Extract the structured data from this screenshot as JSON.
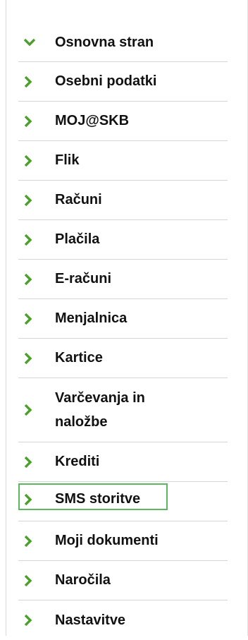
{
  "accent_color": "#4aa028",
  "highlight_color": "#5cb85c",
  "nav": {
    "items": [
      {
        "label": "Osnovna stran",
        "icon": "chevron-down-icon"
      },
      {
        "label": "Osebni podatki",
        "icon": "chevron-right-icon"
      },
      {
        "label": "MOJ@SKB",
        "icon": "chevron-right-icon"
      },
      {
        "label": "Flik",
        "icon": "chevron-right-icon"
      },
      {
        "label": "Računi",
        "icon": "chevron-right-icon"
      },
      {
        "label": "Plačila",
        "icon": "chevron-right-icon"
      },
      {
        "label": "E-računi",
        "icon": "chevron-right-icon"
      },
      {
        "label": "Menjalnica",
        "icon": "chevron-right-icon"
      },
      {
        "label": "Kartice",
        "icon": "chevron-right-icon"
      },
      {
        "label": "Varčevanja in naložbe",
        "icon": "chevron-right-icon"
      },
      {
        "label": "Krediti",
        "icon": "chevron-right-icon"
      },
      {
        "label": "SMS storitve",
        "icon": "chevron-right-icon",
        "highlighted": true
      },
      {
        "label": "Moji dokumenti",
        "icon": "chevron-right-icon"
      },
      {
        "label": "Naročila",
        "icon": "chevron-right-icon"
      },
      {
        "label": "Nastavitve",
        "icon": "chevron-right-icon"
      }
    ]
  }
}
